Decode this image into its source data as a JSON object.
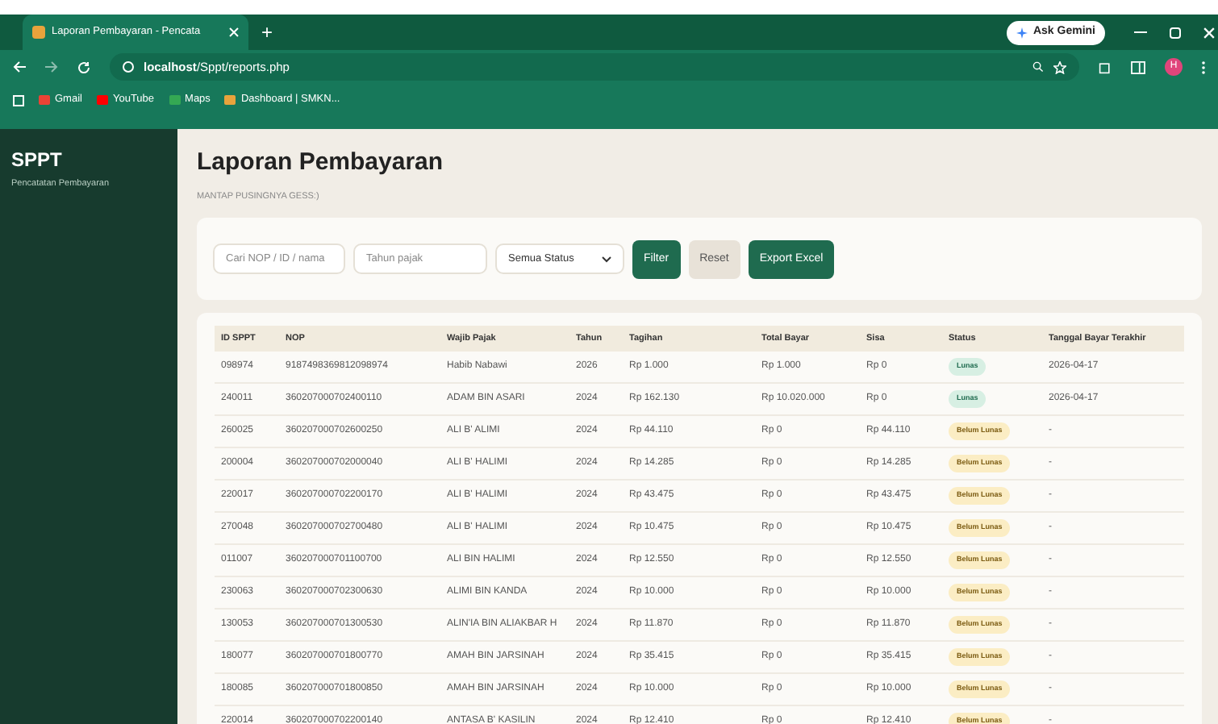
{
  "browser": {
    "tab_title": "Laporan Pembayaran - Pencata",
    "new_tab": "+",
    "url_host": "localhost",
    "url_path": "/Sppt/reports.php",
    "gemini": "Ask Gemini",
    "profile": "H",
    "bookmarks": [
      "Gmail",
      "YouTube",
      "Maps",
      "Dashboard | SMKN..."
    ]
  },
  "sidebar": {
    "title": "SPPT",
    "subtitle": "Pencatatan Pembayaran"
  },
  "page": {
    "title": "Laporan Pembayaran",
    "subtitle": "MANTAP PUSINGNYA GESS:)"
  },
  "filters": {
    "search": {
      "placeholder": "Cari NOP / ID / nama"
    },
    "year": {
      "placeholder": "Tahun pajak"
    },
    "status": {
      "value": "Semua Status"
    },
    "buttons": [
      {
        "label": "Filter",
        "kind": "primary"
      },
      {
        "label": "Reset",
        "kind": "secondary"
      },
      {
        "label": "Export Excel",
        "kind": "primary"
      }
    ]
  },
  "table": {
    "columns": [
      "ID SPPT",
      "NOP",
      "Wajib Pajak",
      "Tahun",
      "Tagihan",
      "Total Bayar",
      "Sisa",
      "Status",
      "Tanggal Bayar Terakhir"
    ],
    "rows": [
      {
        "cells": [
          "098974",
          "9187498369812098974",
          "Habib Nabawi",
          "2026",
          "Rp 1.000",
          "Rp 1.000",
          "Rp 0"
        ],
        "status": "Lunas",
        "kind": "paid",
        "date": "2026-04-17"
      },
      {
        "cells": [
          "240011",
          "360207000702400110",
          "ADAM BIN ASARI",
          "2024",
          "Rp 162.130",
          "Rp 10.020.000",
          "Rp 0"
        ],
        "status": "Lunas",
        "kind": "paid",
        "date": "2026-04-17"
      },
      {
        "cells": [
          "260025",
          "360207000702600250",
          "ALI B' ALIMI",
          "2024",
          "Rp 44.110",
          "Rp 0",
          "Rp 44.110"
        ],
        "status": "Belum Lunas",
        "kind": "unpaid",
        "date": "-"
      },
      {
        "cells": [
          "200004",
          "360207000702000040",
          "ALI B' HALIMI",
          "2024",
          "Rp 14.285",
          "Rp 0",
          "Rp 14.285"
        ],
        "status": "Belum Lunas",
        "kind": "unpaid",
        "date": "-"
      },
      {
        "cells": [
          "220017",
          "360207000702200170",
          "ALI B' HALIMI",
          "2024",
          "Rp 43.475",
          "Rp 0",
          "Rp 43.475"
        ],
        "status": "Belum Lunas",
        "kind": "unpaid",
        "date": "-"
      },
      {
        "cells": [
          "270048",
          "360207000702700480",
          "ALI B' HALIMI",
          "2024",
          "Rp 10.475",
          "Rp 0",
          "Rp 10.475"
        ],
        "status": "Belum Lunas",
        "kind": "unpaid",
        "date": "-"
      },
      {
        "cells": [
          "011007",
          "360207000701100700",
          "ALI BIN HALIMI",
          "2024",
          "Rp 12.550",
          "Rp 0",
          "Rp 12.550"
        ],
        "status": "Belum Lunas",
        "kind": "unpaid",
        "date": "-"
      },
      {
        "cells": [
          "230063",
          "360207000702300630",
          "ALIMI BIN KANDA",
          "2024",
          "Rp 10.000",
          "Rp 0",
          "Rp 10.000"
        ],
        "status": "Belum Lunas",
        "kind": "unpaid",
        "date": "-"
      },
      {
        "cells": [
          "130053",
          "360207000701300530",
          "ALIN'IA BIN ALIAKBAR H",
          "2024",
          "Rp 11.870",
          "Rp 0",
          "Rp 11.870"
        ],
        "status": "Belum Lunas",
        "kind": "unpaid",
        "date": "-"
      },
      {
        "cells": [
          "180077",
          "360207000701800770",
          "AMAH BIN JARSINAH",
          "2024",
          "Rp 35.415",
          "Rp 0",
          "Rp 35.415"
        ],
        "status": "Belum Lunas",
        "kind": "unpaid",
        "date": "-"
      },
      {
        "cells": [
          "180085",
          "360207000701800850",
          "AMAH BIN JARSINAH",
          "2024",
          "Rp 10.000",
          "Rp 0",
          "Rp 10.000"
        ],
        "status": "Belum Lunas",
        "kind": "unpaid",
        "date": "-"
      },
      {
        "cells": [
          "220014",
          "360207000702200140",
          "ANTASA B' KASILIN",
          "2024",
          "Rp 12.410",
          "Rp 0",
          "Rp 12.410"
        ],
        "status": "Belum Lunas",
        "kind": "unpaid",
        "date": "-"
      }
    ]
  }
}
